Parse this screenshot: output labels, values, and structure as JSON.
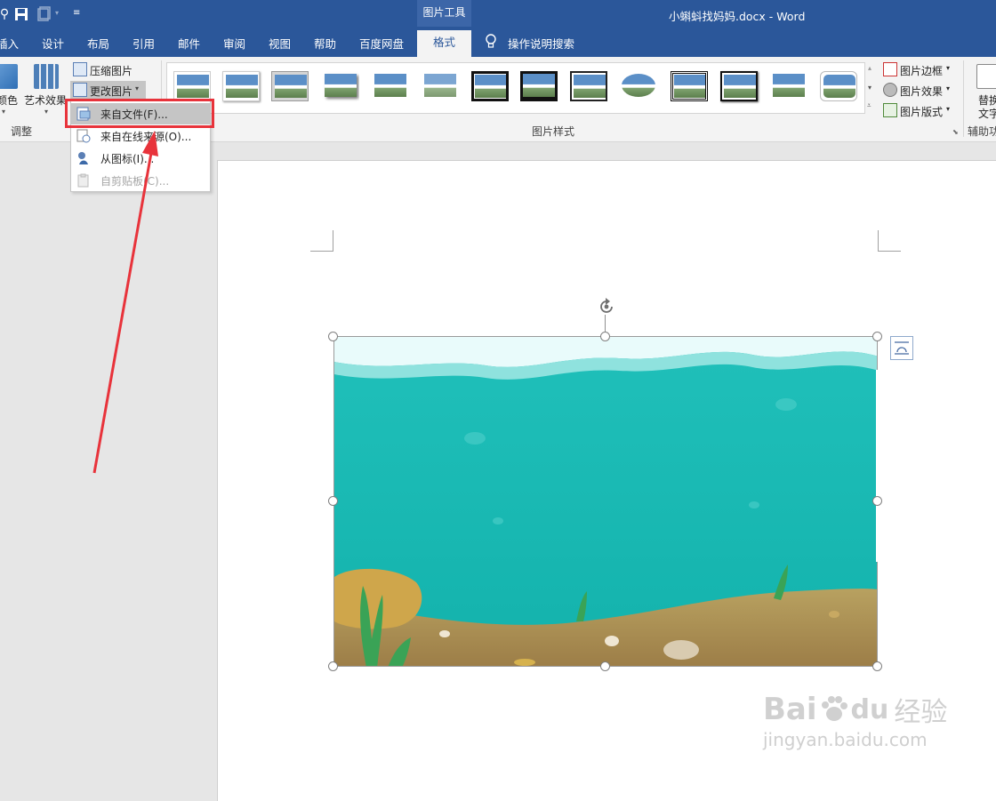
{
  "titlebar": {
    "context_group": "图片工具",
    "doc_title": "小蝌蚪找妈妈.docx  -  Word"
  },
  "tabs": {
    "insert": "插入",
    "design": "设计",
    "layout": "布局",
    "references": "引用",
    "mailings": "邮件",
    "review": "审阅",
    "view": "视图",
    "help": "帮助",
    "baidu": "百度网盘",
    "format": "格式",
    "tell_me": "操作说明搜索"
  },
  "ribbon": {
    "adjust": {
      "color_label": "颜色",
      "artistic_label": "艺术效果",
      "compress_label": "压缩图片",
      "change_label": "更改图片",
      "group_label": "调整"
    },
    "styles": {
      "group_label": "图片样式",
      "border_label": "图片边框",
      "effects_label": "图片效果",
      "layout_label": "图片版式"
    },
    "accessibility": {
      "alt_text_line1": "替换",
      "alt_text_line2": "文字",
      "group_label": "辅助功"
    }
  },
  "menu": {
    "items": [
      {
        "label": "来自文件(F)...",
        "state": "hover"
      },
      {
        "label": "来自在线来源(O)...",
        "state": "normal"
      },
      {
        "label": "从图标(I)...",
        "state": "normal"
      },
      {
        "label": "自剪贴板(C)...",
        "state": "disabled"
      }
    ]
  },
  "watermark": {
    "brand": "Bai",
    "brand2": "du",
    "jingyan": "经验",
    "url": "jingyan.baidu.com"
  },
  "colors": {
    "title_blue": "#2b579a",
    "highlight_red": "#e8333b",
    "water": "#17b6b0"
  }
}
